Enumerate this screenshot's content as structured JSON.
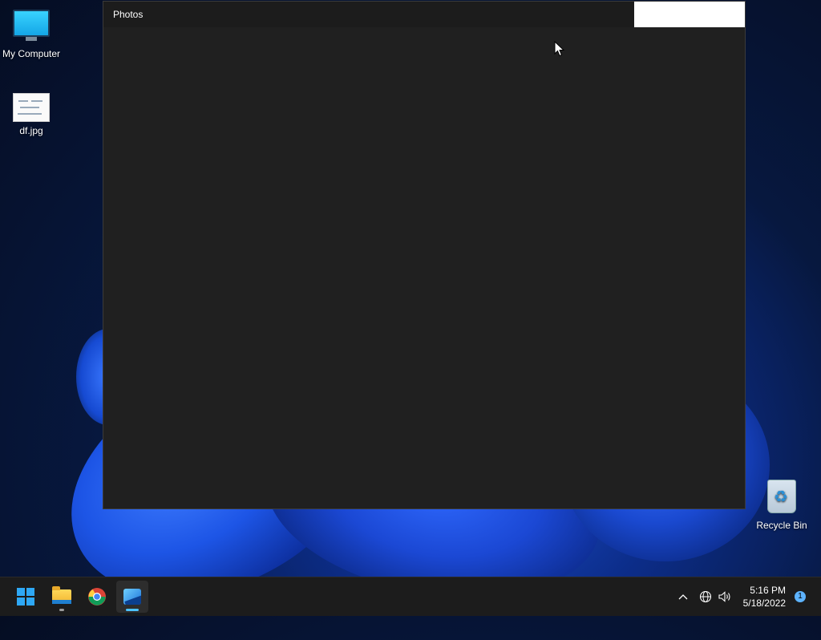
{
  "desktop": {
    "icons": [
      {
        "label": "My Computer"
      },
      {
        "label": "df.jpg"
      },
      {
        "label": "Recycle Bin"
      }
    ]
  },
  "window": {
    "title": "Photos"
  },
  "taskbar": {
    "apps": [
      {
        "name": "start-icon"
      },
      {
        "name": "file-explorer-icon"
      },
      {
        "name": "chrome-icon"
      },
      {
        "name": "photos-icon"
      }
    ],
    "tray": {
      "time": "5:16 PM",
      "date": "5/18/2022",
      "notification_count": "1"
    }
  },
  "colors": {
    "accent": "#2ea8f5",
    "window_bg": "#202020",
    "taskbar_bg": "#1c1c1c"
  }
}
